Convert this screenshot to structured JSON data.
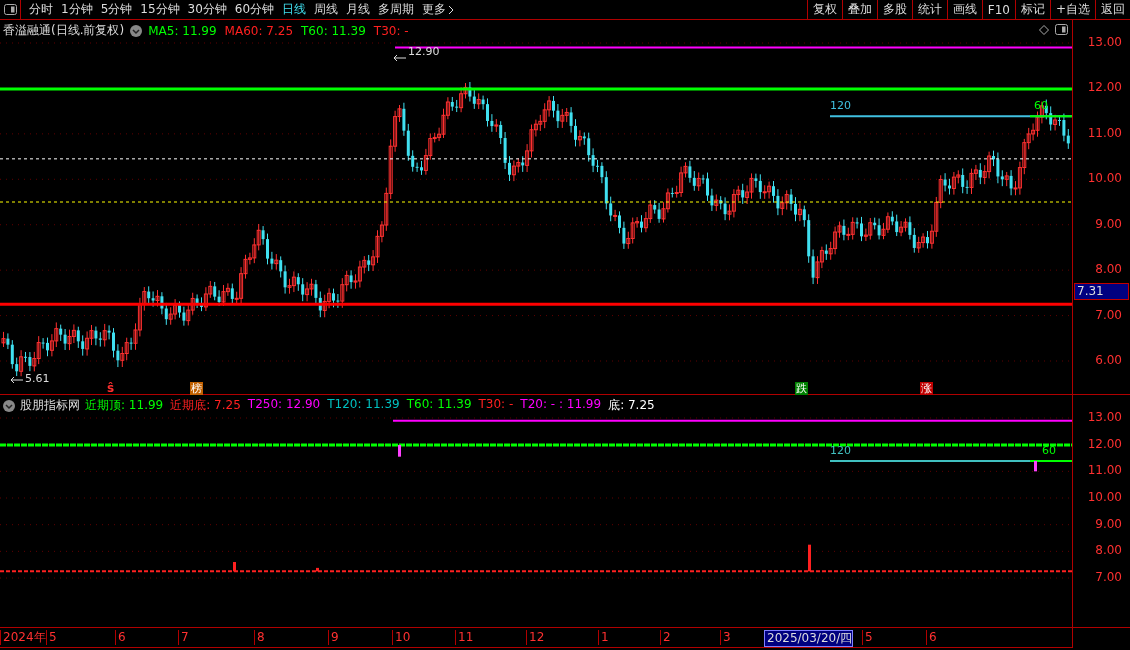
{
  "period_tabs": [
    {
      "label": "分时",
      "selected": false
    },
    {
      "label": "1分钟",
      "selected": false
    },
    {
      "label": "5分钟",
      "selected": false
    },
    {
      "label": "15分钟",
      "selected": false
    },
    {
      "label": "30分钟",
      "selected": false
    },
    {
      "label": "60分钟",
      "selected": false
    },
    {
      "label": "日线",
      "selected": true
    },
    {
      "label": "周线",
      "selected": false
    },
    {
      "label": "月线",
      "selected": false
    },
    {
      "label": "多周期",
      "selected": false
    },
    {
      "label": "更多",
      "selected": false
    }
  ],
  "tool_buttons": [
    "复权",
    "叠加",
    "多股",
    "统计",
    "画线",
    "F10",
    "标记",
    "+自选",
    "返回"
  ],
  "main_chart": {
    "title": "香溢融通(日线.前复权)",
    "legend": [
      {
        "label": "MA5: 11.99",
        "color": "#00ff00"
      },
      {
        "label": "MA60: 7.25",
        "color": "#ff2020"
      },
      {
        "label": "T60: 11.39",
        "color": "#00ff00"
      },
      {
        "label": "T30: -",
        "color": "#ff2020"
      }
    ],
    "high_label": "12.90",
    "low_label": "5.61",
    "line_labels": [
      "120",
      "60"
    ],
    "markers": [
      {
        "kind": "signal",
        "label": "ŝ"
      },
      {
        "kind": "badge",
        "label": "榜",
        "color": "#c06000"
      },
      {
        "kind": "badge",
        "label": "跌",
        "color": "#008000"
      },
      {
        "kind": "badge",
        "label": "涨",
        "color": "#c00000"
      }
    ],
    "price_tag": "7.31",
    "y_ticks": [
      "13.00",
      "12.00",
      "11.00",
      "10.00",
      "9.00",
      "8.00",
      "7.00",
      "6.00"
    ]
  },
  "indicator_chart": {
    "title": "股朋指标网",
    "legend": [
      {
        "label": "近期顶: 11.99",
        "color": "#00ff00"
      },
      {
        "label": "近期底: 7.25",
        "color": "#ff2020"
      },
      {
        "label": "T250: 12.90",
        "color": "#ff00ff"
      },
      {
        "label": "T120: 11.39",
        "color": "#00c0c0"
      },
      {
        "label": "T60: 11.39",
        "color": "#00ff00"
      },
      {
        "label": "T30: -",
        "color": "#ff2020"
      },
      {
        "label": "T20: - : 11.99",
        "color": "#ff00ff"
      },
      {
        "label": "底: 7.25",
        "color": "#ffffff"
      }
    ],
    "line_labels": [
      "120",
      "60"
    ],
    "y_ticks": [
      "13.00",
      "12.00",
      "11.00",
      "10.00",
      "9.00",
      "8.00",
      "7.00"
    ]
  },
  "date_axis": [
    {
      "label": "2024年",
      "selected": false
    },
    {
      "label": "5",
      "selected": false
    },
    {
      "label": "6",
      "selected": false
    },
    {
      "label": "7",
      "selected": false
    },
    {
      "label": "8",
      "selected": false
    },
    {
      "label": "9",
      "selected": false
    },
    {
      "label": "10",
      "selected": false
    },
    {
      "label": "11",
      "selected": false
    },
    {
      "label": "12",
      "selected": false
    },
    {
      "label": "1",
      "selected": false
    },
    {
      "label": "2",
      "selected": false
    },
    {
      "label": "3",
      "selected": false
    },
    {
      "label": "2025/03/20/四",
      "selected": true
    },
    {
      "label": "5",
      "selected": false
    },
    {
      "label": "6",
      "selected": false
    }
  ]
}
